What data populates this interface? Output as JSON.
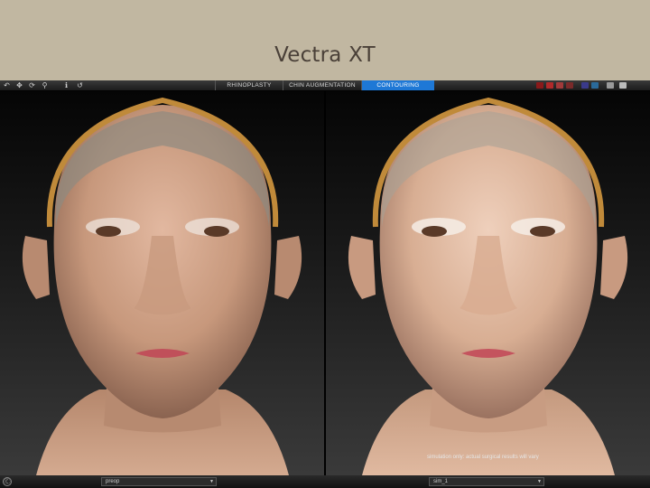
{
  "slide": {
    "title": "Vectra XT"
  },
  "toolbar": {
    "tools": [
      "undo-icon",
      "move-icon",
      "rotate-icon",
      "zoom-icon",
      "info-icon",
      "reset-icon"
    ],
    "tabs": [
      {
        "label": "RHINOPLASTY",
        "active": false
      },
      {
        "label": "CHIN AUGMENTATION",
        "active": false
      },
      {
        "label": "CONTOURING",
        "active": true
      }
    ],
    "tray_colors": [
      "#8a1a1a",
      "#b02a2a",
      "#a13a3a",
      "#7a2a2a",
      "#3a3a8a",
      "#2a6a9a",
      "#999999",
      "#bbbbbb"
    ]
  },
  "viewports": {
    "left": {
      "select_value": "preop"
    },
    "right": {
      "select_value": "sim_1",
      "disclaimer": "simulation only: actual surgical results will vary"
    }
  },
  "colors": {
    "accent": "#1e78d6",
    "header_bg": "#c1b7a1",
    "title_color": "#4a4038"
  }
}
